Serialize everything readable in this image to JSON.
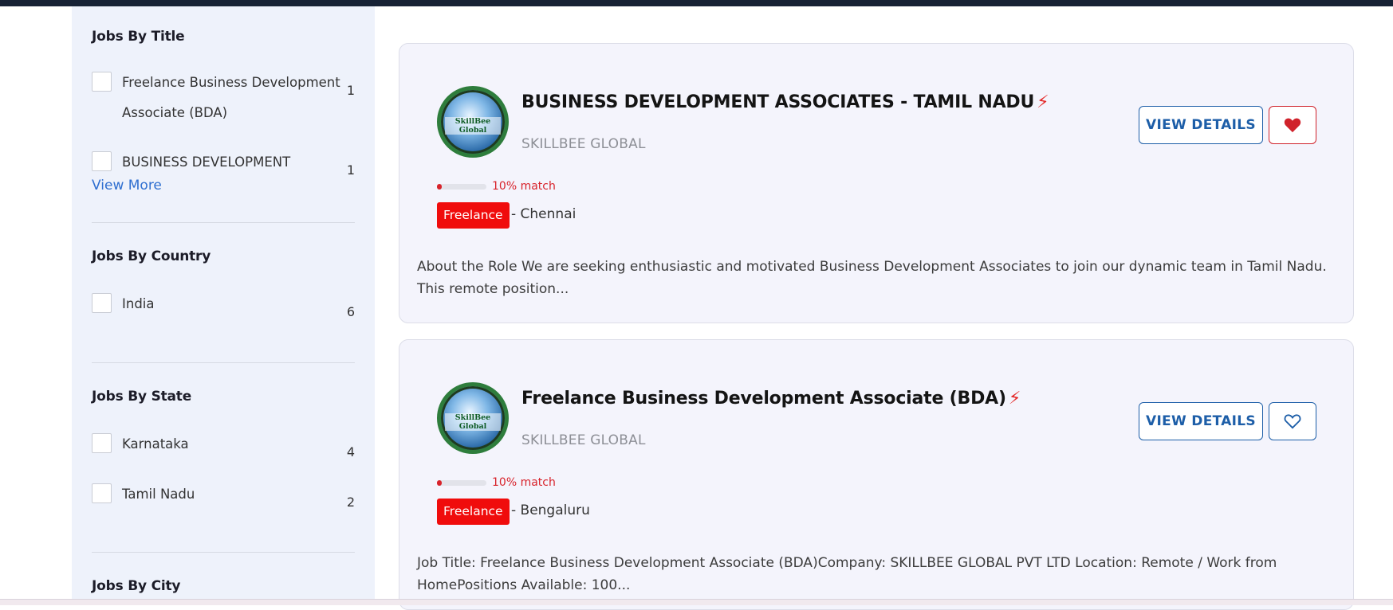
{
  "sidebar": {
    "title_section": {
      "heading": "Jobs By Title",
      "items": [
        {
          "label_line1": "Freelance Business Development",
          "label_line2": "Associate (BDA)",
          "count": "1"
        },
        {
          "label_line1": "BUSINESS DEVELOPMENT",
          "count": "1"
        }
      ],
      "view_more": "View More"
    },
    "country_section": {
      "heading": "Jobs By Country",
      "items": [
        {
          "label": "India",
          "count": "6"
        }
      ]
    },
    "state_section": {
      "heading": "Jobs By State",
      "items": [
        {
          "label": "Karnataka",
          "count": "4"
        },
        {
          "label": "Tamil Nadu",
          "count": "2"
        }
      ]
    },
    "city_section": {
      "heading": "Jobs By City"
    }
  },
  "jobs": [
    {
      "logo_text": "SkillBee Global",
      "title": "BUSINESS DEVELOPMENT ASSOCIATES - TAMIL NADU",
      "company": "SKILLBEE GLOBAL",
      "view_label": "VIEW DETAILS",
      "favorited": true,
      "match_fraction": 0.1,
      "match_text": "10% match",
      "tag": "Freelance",
      "location": "- Chennai",
      "description": "About the Role We are seeking enthusiastic and motivated Business Development Associates to join our dynamic team in Tamil Nadu. This remote position..."
    },
    {
      "logo_text": "SkillBee Global",
      "title": "Freelance Business Development Associate (BDA)",
      "company": "SKILLBEE GLOBAL",
      "view_label": "VIEW DETAILS",
      "favorited": false,
      "match_fraction": 0.1,
      "match_text": "10% match",
      "tag": "Freelance",
      "location": "- Bengaluru",
      "description": "Job Title: Freelance Business Development Associate (BDA)Company: SKILLBEE GLOBAL PVT LTD Location: Remote / Work from HomePositions Available: 100..."
    }
  ],
  "colors": {
    "accent_blue": "#1d5ea8",
    "accent_red": "#d8232b",
    "tag_red": "#f00c0c",
    "sidebar_bg": "#eef2fb"
  },
  "icons": {
    "bolt": "lightning-icon",
    "favorite_filled": "heart-filled-icon",
    "favorite_outline": "heart-outline-icon"
  }
}
